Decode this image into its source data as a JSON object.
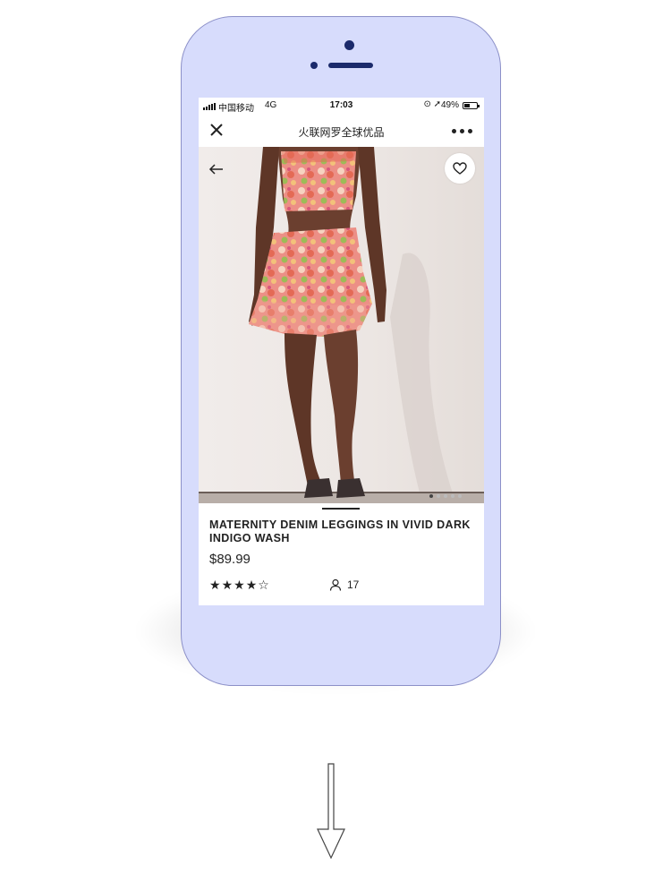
{
  "status_bar": {
    "carrier": "中国移动",
    "network": "4G",
    "time": "17:03",
    "battery": "49%",
    "battery_level": 0.49
  },
  "nav": {
    "title": "火联网罗全球优品",
    "close_icon": "close-icon",
    "more_icon": "more-icon"
  },
  "product": {
    "title": "MATERNITY DENIM LEGGINGS IN VIVID DARK INDIGO WASH",
    "price": "$89.99",
    "rating": 4,
    "rating_max": 5,
    "review_count": "17",
    "image_count": 5,
    "current_image": 1
  },
  "icons": {
    "back": "back-arrow-icon",
    "favorite": "heart-icon",
    "user": "user-icon",
    "down": "down-arrow-icon"
  },
  "colors": {
    "phone_body": "#d7dcfc",
    "phone_details": "#1b2a6b",
    "text": "#222222"
  }
}
